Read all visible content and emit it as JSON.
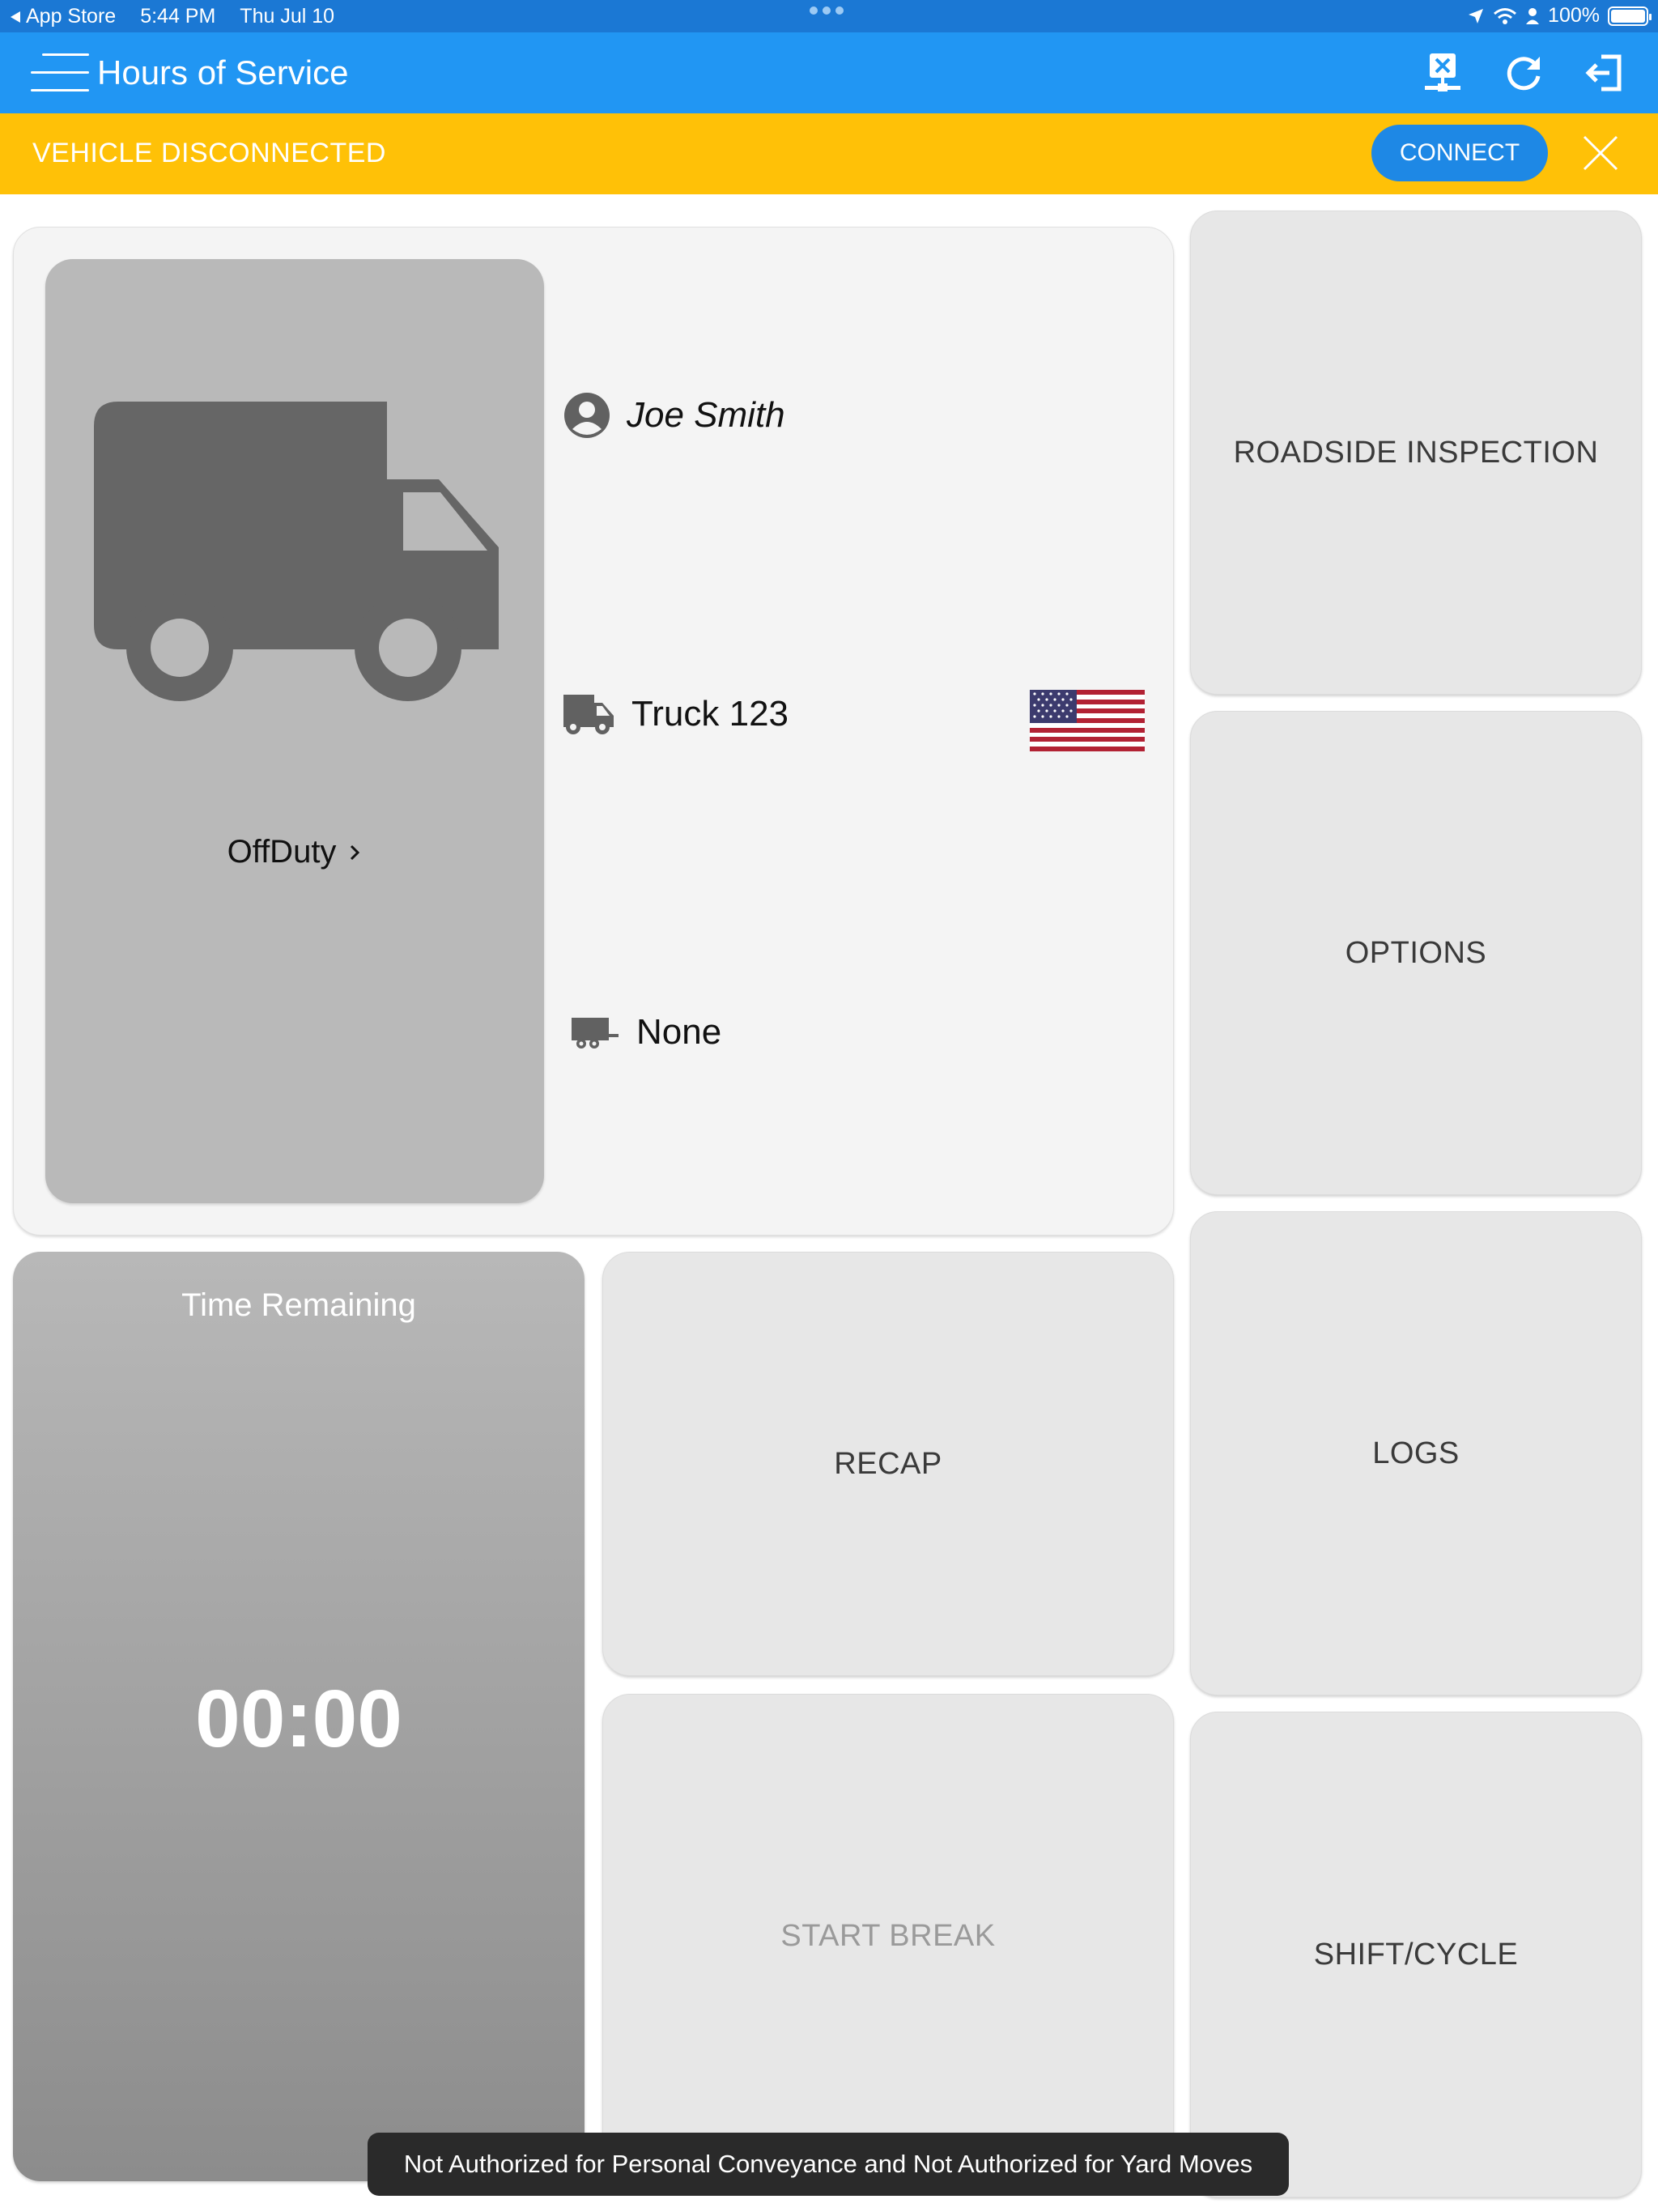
{
  "status_bar": {
    "back_app": "App Store",
    "time": "5:44 PM",
    "date": "Thu Jul 10",
    "battery": "100%",
    "icons": [
      "location-arrow-icon",
      "wifi-icon",
      "person-icon",
      "battery-icon"
    ]
  },
  "nav": {
    "title": "Hours of Service",
    "icons": [
      "network-disconnected-icon",
      "refresh-icon",
      "logout-icon"
    ]
  },
  "banner": {
    "message": "VEHICLE DISCONNECTED",
    "connect_label": "CONNECT",
    "color": "#ffc107"
  },
  "driver": {
    "name": "Joe Smith",
    "truck": "Truck 123",
    "trailer": "None",
    "duty_status": "OffDuty",
    "country_flag": "us-flag-icon"
  },
  "tiles": {
    "roadside_inspection": "ROADSIDE INSPECTION",
    "options": "OPTIONS",
    "logs": "LOGS",
    "recap": "RECAP",
    "start_break": "START BREAK",
    "shift_cycle": "SHIFT/CYCLE"
  },
  "time_remaining": {
    "label": "Time Remaining",
    "value": "00:00"
  },
  "toast": {
    "message": "Not Authorized for Personal Conveyance and Not Authorized for Yard Moves"
  },
  "colors": {
    "status_bar": "#1b78d4",
    "nav_bar": "#2196f3",
    "accent": "#1e88e5",
    "tile": "#e7e7e7"
  }
}
